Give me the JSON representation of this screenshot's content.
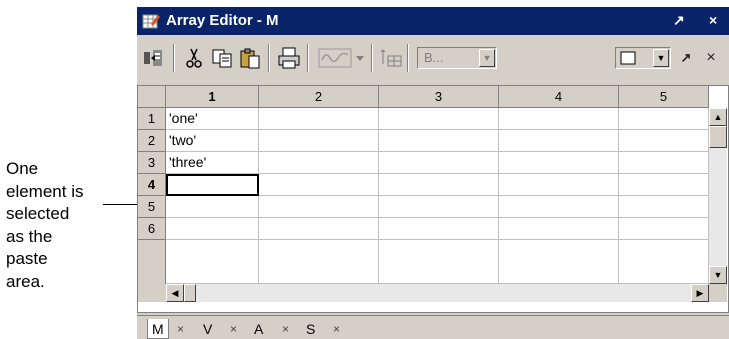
{
  "callout": {
    "lines": [
      "One",
      "element is",
      "selected",
      "as the",
      "paste",
      "area."
    ]
  },
  "window": {
    "title": "Array Editor - M",
    "undock_glyph": "↗",
    "close_glyph": "×"
  },
  "toolbar": {
    "icons": [
      "import-data-icon",
      "cut-icon",
      "copy-icon",
      "paste-icon",
      "print-icon",
      "plot-icon",
      "plot-dropdown-icon",
      "table-icon"
    ],
    "format_combo_value": "B...",
    "undock_glyph": "↗",
    "close_glyph": "×"
  },
  "grid": {
    "columns": [
      "1",
      "2",
      "3",
      "4",
      "5"
    ],
    "rows": [
      "1",
      "2",
      "3",
      "4",
      "5",
      "6"
    ],
    "cells": [
      [
        "'one'",
        "",
        "",
        "",
        ""
      ],
      [
        "'two'",
        "",
        "",
        "",
        ""
      ],
      [
        "'three'",
        "",
        "",
        "",
        ""
      ],
      [
        "",
        "",
        "",
        "",
        ""
      ],
      [
        "",
        "",
        "",
        "",
        ""
      ],
      [
        "",
        "",
        "",
        "",
        ""
      ]
    ],
    "selected_row": "4",
    "selected_column": "1"
  },
  "tabs": [
    {
      "label": "M",
      "active": true
    },
    {
      "label": "V",
      "active": false
    },
    {
      "label": "A",
      "active": false
    },
    {
      "label": "S",
      "active": false
    }
  ],
  "tab_close_glyph": "×"
}
